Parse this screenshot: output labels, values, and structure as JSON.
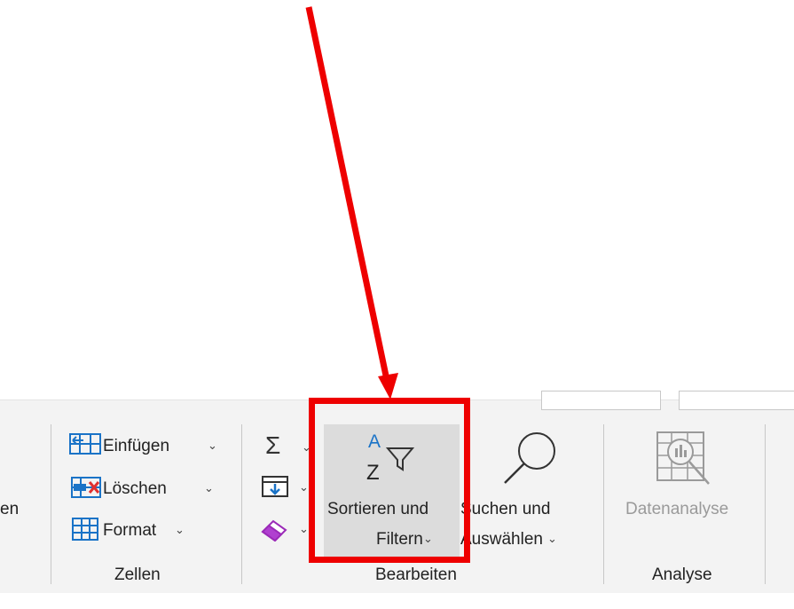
{
  "ribbon": {
    "cut_off_left_label": "en",
    "zellen": {
      "insert_label": "Einfügen",
      "delete_label": "Löschen",
      "format_label": "Format",
      "group_label": "Zellen"
    },
    "bearbeiten": {
      "sort_filter_line1": "Sortieren und",
      "sort_filter_line2": "Filtern",
      "find_select_line1": "Suchen und",
      "find_select_line2": "Auswählen",
      "group_label": "Bearbeiten"
    },
    "analyse": {
      "data_analysis_label": "Datenanalyse",
      "group_label": "Analyse"
    },
    "chevron": "⌄"
  },
  "annotation": {
    "arrow_color": "#ee0000",
    "highlight_color": "#ee0000"
  },
  "icons": {
    "sum": "Σ",
    "sort_a": "A",
    "sort_z": "Z"
  }
}
